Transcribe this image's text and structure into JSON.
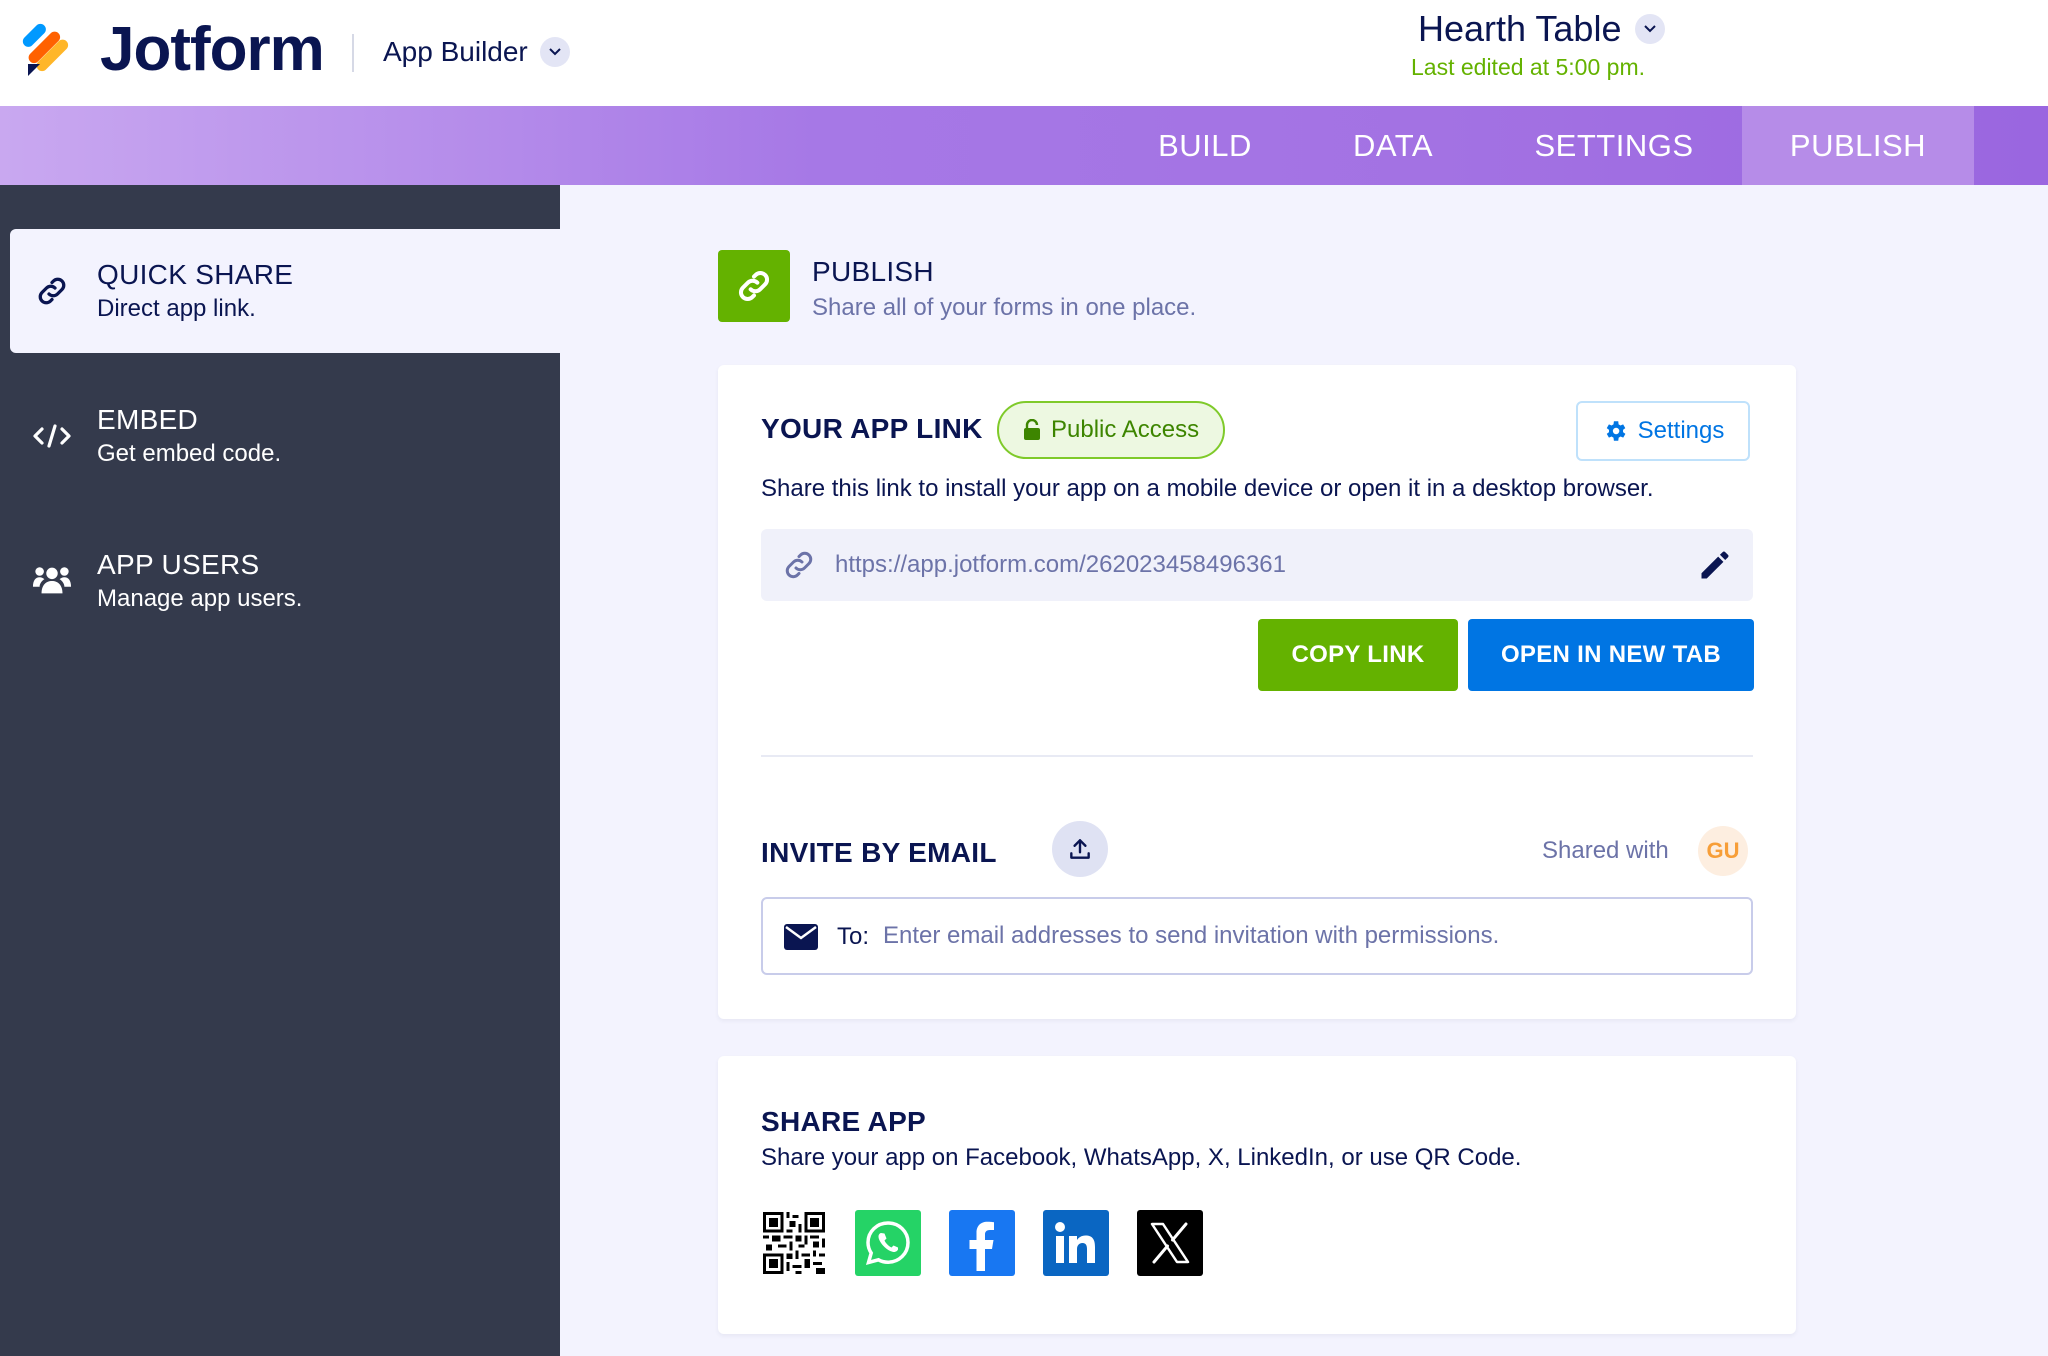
{
  "header": {
    "logo_text": "Jotform",
    "app_builder_label": "App Builder",
    "app_title": "Hearth Table",
    "last_edited": "Last edited at 5:00 pm."
  },
  "nav": {
    "tabs": [
      {
        "label": "BUILD",
        "active": false
      },
      {
        "label": "DATA",
        "active": false
      },
      {
        "label": "SETTINGS",
        "active": false
      },
      {
        "label": "PUBLISH",
        "active": true
      }
    ]
  },
  "sidebar": {
    "items": [
      {
        "title": "QUICK SHARE",
        "desc": "Direct app link.",
        "icon": "link-icon",
        "active": true
      },
      {
        "title": "EMBED",
        "desc": "Get embed code.",
        "icon": "code-icon",
        "active": false
      },
      {
        "title": "APP USERS",
        "desc": "Manage app users.",
        "icon": "users-icon",
        "active": false
      }
    ]
  },
  "publish": {
    "title": "PUBLISH",
    "subtitle": "Share all of your forms in one place."
  },
  "app_link": {
    "title": "YOUR APP LINK",
    "access_label": "Public Access",
    "settings_label": "Settings",
    "description": "Share this link to install your app on a mobile device or open it in a desktop browser.",
    "url": "https://app.jotform.com/262023458496361",
    "copy_label": "COPY LINK",
    "open_label": "OPEN IN NEW TAB"
  },
  "invite": {
    "title": "INVITE BY EMAIL",
    "shared_with_label": "Shared with",
    "avatar_initials": "GU",
    "to_label": "To:",
    "placeholder": "Enter email addresses to send invitation with permissions."
  },
  "share_app": {
    "title": "SHARE APP",
    "description": "Share your app on Facebook, WhatsApp, X, LinkedIn, or use QR Code.",
    "icons": [
      "qr-code-icon",
      "whatsapp-icon",
      "facebook-icon",
      "linkedin-icon",
      "x-icon"
    ]
  },
  "colors": {
    "brand_green": "#64b200",
    "brand_blue": "#0075e3",
    "navy": "#0a1551",
    "sidebar_bg": "#343a4c",
    "nav_purple": "#a678e6"
  }
}
